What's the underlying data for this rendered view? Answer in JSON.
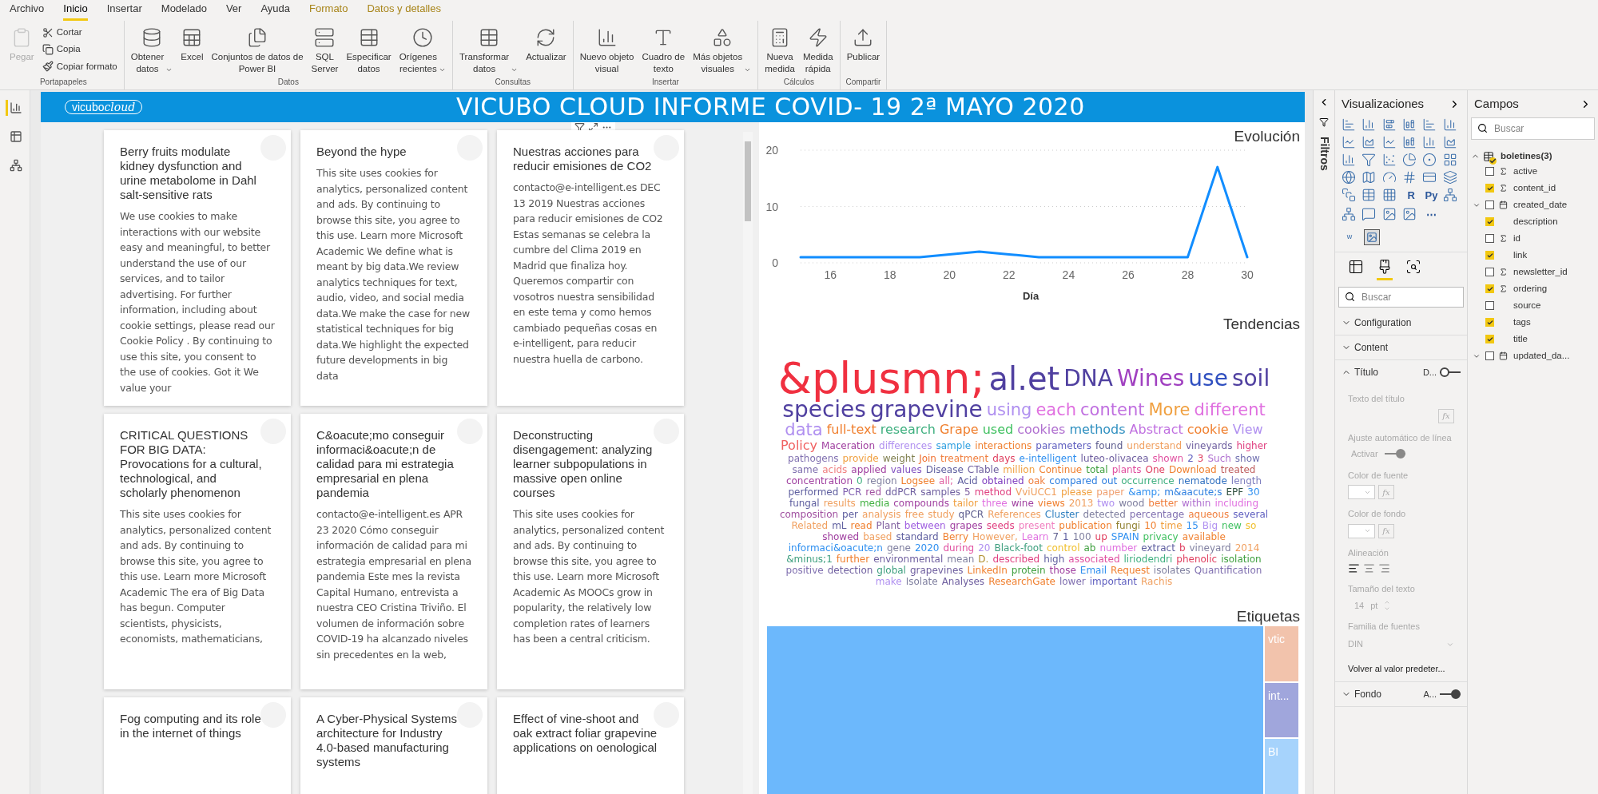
{
  "ribbon": {
    "tabs": [
      {
        "label": "Archivo",
        "selected": false,
        "kind": "normal"
      },
      {
        "label": "Inicio",
        "selected": true,
        "kind": "normal"
      },
      {
        "label": "Insertar",
        "selected": false,
        "kind": "normal"
      },
      {
        "label": "Modelado",
        "selected": false,
        "kind": "normal"
      },
      {
        "label": "Ver",
        "selected": false,
        "kind": "normal"
      },
      {
        "label": "Ayuda",
        "selected": false,
        "kind": "normal"
      },
      {
        "label": "Formato",
        "selected": false,
        "kind": "contextual"
      },
      {
        "label": "Datos y detalles",
        "selected": false,
        "kind": "contextual"
      }
    ],
    "groups": [
      {
        "label": "Portapapeles",
        "buttons": [
          {
            "label": "Pegar",
            "kind": "large",
            "disabled": true
          },
          {
            "label": "Cortar",
            "kind": "small",
            "disabled": false
          },
          {
            "label": "Copia",
            "kind": "small",
            "disabled": false
          },
          {
            "label": "Copiar formato",
            "kind": "small",
            "disabled": false
          }
        ]
      },
      {
        "label": "Datos",
        "buttons": [
          {
            "label": "Obtener\ndatos",
            "kind": "large",
            "disabled": false,
            "dropdown": true
          },
          {
            "label": "Excel",
            "kind": "large",
            "disabled": false
          },
          {
            "label": "Conjuntos de datos de\nPower BI",
            "kind": "large",
            "disabled": false
          },
          {
            "label": "SQL\nServer",
            "kind": "large",
            "disabled": false
          },
          {
            "label": "Especificar\ndatos",
            "kind": "large",
            "disabled": false
          },
          {
            "label": "Orígenes\nrecientes",
            "kind": "large",
            "disabled": false,
            "dropdown": true
          }
        ]
      },
      {
        "label": "Consultas",
        "buttons": [
          {
            "label": "Transformar\ndatos",
            "kind": "large",
            "disabled": false,
            "dropdown": true
          },
          {
            "label": "Actualizar",
            "kind": "large",
            "disabled": false
          }
        ]
      },
      {
        "label": "Insertar",
        "buttons": [
          {
            "label": "Nuevo objeto\nvisual",
            "kind": "large",
            "disabled": false
          },
          {
            "label": "Cuadro de\ntexto",
            "kind": "large",
            "disabled": false
          },
          {
            "label": "Más objetos\nvisuales",
            "kind": "large",
            "disabled": false,
            "dropdown": true
          }
        ]
      },
      {
        "label": "Cálculos",
        "buttons": [
          {
            "label": "Nueva\nmedida",
            "kind": "large",
            "disabled": false
          },
          {
            "label": "Medida\nrápida",
            "kind": "large",
            "disabled": false
          }
        ]
      },
      {
        "label": "Compartir",
        "buttons": [
          {
            "label": "Publicar",
            "kind": "large",
            "disabled": false
          }
        ]
      }
    ]
  },
  "view_rail": [
    {
      "selected": true
    },
    {
      "selected": false
    },
    {
      "selected": false
    }
  ],
  "report": {
    "header": {
      "logo_text": "vicubo",
      "logo_script": "cloud",
      "title": "VICUBO CLOUD INFORME COVID- 19 2ª MAYO 2020"
    },
    "cards": [
      {
        "title": "Berry fruits modulate kidney dysfunction and urine metabolome in Dahl salt-sensitive rats",
        "body": "We use cookies to make interactions with our website easy and meaningful, to better understand the use of our services, and to tailor advertising. For further information, including about cookie settings, please read our Cookie Policy . By continuing to use this site, you consent to the use of cookies. Got it We value your"
      },
      {
        "title": "Beyond the hype",
        "body": "This site uses cookies for analytics, personalized content and ads. By continuing to browse this site, you agree to this use. Learn more Microsoft Academic We define what is meant by big data.We review analytics techniques for text, audio, video, and social media data.We make the case for new statistical techniques for big data.We highlight the expected future developments in big data"
      },
      {
        "title": "Nuestras acciones para reducir emisiones de CO2",
        "body": "contacto@e-intelligent.es DEC 13 2019 Nuestras acciones para reducir emisiones de CO2 Estas semanas se celebra la cumbre del Clima 2019 en Madrid que finaliza hoy.  Queremos compartir con vosotros nuestra sensibilidad en este tema y como hemos cambiado pequeñas cosas en e-intelligent, para reducir nuestra huella de carbono."
      },
      {
        "title": "CRITICAL QUESTIONS FOR BIG DATA: Provocations for a cultural, technological, and scholarly phenomenon",
        "body": "This site uses cookies for analytics, personalized content and ads. By continuing to browse this site, you agree to this use. Learn more Microsoft Academic The era of Big Data has begun. Computer scientists, physicists, economists, mathematicians,"
      },
      {
        "title": "C&oacute;mo conseguir informaci&oacute;n de calidad para mi estrategia empresarial en plena pandemia",
        "body": "contacto@e-intelligent.es APR 23 2020 Cómo conseguir información de calidad para mi estrategia empresarial en plena pandemia Este mes la revista Capital Humano, entrevista a nuestra CEO Cristina Triviño. El volumen de información sobre COVID-19 ha alcanzado niveles sin precedentes en la web,"
      },
      {
        "title": "Deconstructing disengagement: analyzing learner subpopulations in massive open online courses",
        "body": "This site uses cookies for analytics, personalized content and ads. By continuing to browse this site, you agree to this use. Learn more Microsoft Academic As MOOCs grow in popularity, the relatively low completion rates of learners has been a central criticism."
      },
      {
        "title": "Fog computing and its role in the internet of things"
      },
      {
        "title": "A Cyber-Physical Systems architecture for Industry 4.0-based manufacturing systems"
      },
      {
        "title": "Effect of vine-shoot and oak extract foliar grapevine applications on oenological"
      }
    ],
    "evolution": {
      "chart_data": {
        "type": "line",
        "title": "Evolución",
        "xlabel": "Día",
        "x": [
          15,
          16,
          17,
          18,
          19,
          20,
          21,
          22,
          23,
          24,
          25,
          26,
          27,
          28,
          29,
          30
        ],
        "series": [
          {
            "color": "#118dff",
            "values": [
              1,
              1,
              1,
              1,
              1,
              1.5,
              2,
              1.5,
              1,
              1,
              1,
              1,
              1,
              1,
              17,
              1
            ]
          }
        ],
        "xlim": [
          15,
          30
        ],
        "ylim": [
          0,
          20
        ],
        "xticks": [
          16,
          18,
          20,
          22,
          24,
          26,
          28,
          30
        ],
        "yticks": [
          0,
          10,
          20
        ]
      }
    },
    "trends": {
      "title": "Tendencias",
      "words": [
        {
          "text": "&plusmn;",
          "color": "#f03040"
        },
        {
          "text": "al.et",
          "color": "#5040a0"
        },
        {
          "text": "DNA",
          "color": "#5040a0"
        },
        {
          "text": "Wines",
          "color": "#a040c0"
        },
        {
          "text": "use",
          "color": "#3050c0"
        },
        {
          "text": "soil",
          "color": "#5040a0"
        },
        {
          "text": "species",
          "color": "#5040a0"
        },
        {
          "text": "grapevine",
          "color": "#5040a0"
        },
        {
          "text": "using",
          "color": "#b090f0"
        },
        {
          "text": "each",
          "color": "#e070e0"
        },
        {
          "text": "content",
          "color": "#c070e0"
        },
        {
          "text": "More",
          "color": "#f0a040"
        },
        {
          "text": "different",
          "color": "#e070e0"
        },
        {
          "text": "data",
          "color": "#b090f0"
        },
        {
          "text": "full-text",
          "color": "#f08030"
        },
        {
          "text": "research",
          "color": "#40b080"
        },
        {
          "text": "Grape",
          "color": "#f08030"
        },
        {
          "text": "used",
          "color": "#40c060"
        },
        {
          "text": "cookies",
          "color": "#b070d0"
        },
        {
          "text": "methods",
          "color": "#3090c0"
        },
        {
          "text": "Abstract",
          "color": "#c070e0"
        },
        {
          "text": "cookie",
          "color": "#f08030"
        },
        {
          "text": "View",
          "color": "#b090f0"
        },
        {
          "text": "Policy",
          "color": "#f06060"
        },
        {
          "text": "Maceration",
          "color": "#a040a0"
        },
        {
          "text": "differences",
          "color": "#b090f0"
        },
        {
          "text": "sample",
          "color": "#30a0e0"
        },
        {
          "text": "interactions",
          "color": "#f08030"
        },
        {
          "text": "parameters",
          "color": "#6060c0"
        },
        {
          "text": "found",
          "color": "#606090"
        },
        {
          "text": "understand",
          "color": "#f0a060"
        },
        {
          "text": "vineyards",
          "color": "#7060a0"
        },
        {
          "text": "higher",
          "color": "#e04080"
        },
        {
          "text": "pathogens",
          "color": "#8070b0"
        },
        {
          "text": "provide",
          "color": "#f0a040"
        },
        {
          "text": "weight",
          "color": "#808050"
        },
        {
          "text": "Join",
          "color": "#f07030"
        },
        {
          "text": "treatment",
          "color": "#f08040"
        },
        {
          "text": "days",
          "color": "#e04060"
        },
        {
          "text": "e-intelligent",
          "color": "#3090f0"
        },
        {
          "text": "luteo-olivacea",
          "color": "#7060a0"
        },
        {
          "text": "shown",
          "color": "#e050a0"
        },
        {
          "text": "2",
          "color": "#6060c0"
        },
        {
          "text": "3",
          "color": "#e04060"
        },
        {
          "text": "Such",
          "color": "#b070d0"
        },
        {
          "text": "show",
          "color": "#7070b0"
        },
        {
          "text": "same",
          "color": "#8070b0"
        },
        {
          "text": "acids",
          "color": "#f08080"
        },
        {
          "text": "applied",
          "color": "#a040a0"
        },
        {
          "text": "values",
          "color": "#8050c0"
        },
        {
          "text": "Disease",
          "color": "#6060a0"
        },
        {
          "text": "CTable",
          "color": "#7060a0"
        },
        {
          "text": "million",
          "color": "#f0a040"
        },
        {
          "text": "Continue",
          "color": "#f08030"
        },
        {
          "text": "total",
          "color": "#40a040"
        },
        {
          "text": "plants",
          "color": "#e050a0"
        },
        {
          "text": "One",
          "color": "#e04060"
        },
        {
          "text": "Download",
          "color": "#f08030"
        },
        {
          "text": "treated",
          "color": "#c06060"
        },
        {
          "text": "concentration",
          "color": "#a040a0"
        },
        {
          "text": "0",
          "color": "#40b080"
        },
        {
          "text": "region",
          "color": "#8080a0"
        },
        {
          "text": "Logsee",
          "color": "#f08030"
        },
        {
          "text": "all;",
          "color": "#e060a0"
        },
        {
          "text": "Acid",
          "color": "#6060a0"
        },
        {
          "text": "obtained",
          "color": "#8040c0"
        },
        {
          "text": "oak",
          "color": "#f08040"
        },
        {
          "text": "compared",
          "color": "#3080e0"
        },
        {
          "text": "out",
          "color": "#3080e0"
        },
        {
          "text": "occurrence",
          "color": "#40b080"
        },
        {
          "text": "nematode",
          "color": "#3070c0"
        },
        {
          "text": "length",
          "color": "#8080c0"
        },
        {
          "text": "performed",
          "color": "#6060a0"
        },
        {
          "text": "PCR",
          "color": "#8060b0"
        },
        {
          "text": "red",
          "color": "#a050a0"
        },
        {
          "text": "ddPCR",
          "color": "#7060a0"
        },
        {
          "text": "samples",
          "color": "#7060a0"
        },
        {
          "text": "5",
          "color": "#8060a0"
        },
        {
          "text": "method",
          "color": "#e04080"
        },
        {
          "text": "VviUCC1",
          "color": "#f0a060"
        },
        {
          "text": "please",
          "color": "#f0a040"
        },
        {
          "text": "paper",
          "color": "#f0a070"
        },
        {
          "text": "&amp;",
          "color": "#3090f0"
        },
        {
          "text": "m&aacute;s",
          "color": "#3080e0"
        },
        {
          "text": "EPF",
          "color": "#305040"
        },
        {
          "text": "30",
          "color": "#3090f0"
        },
        {
          "text": "fungal",
          "color": "#6060a0"
        },
        {
          "text": "results",
          "color": "#f0a060"
        },
        {
          "text": "media",
          "color": "#40b040"
        },
        {
          "text": "compounds",
          "color": "#a040a0"
        },
        {
          "text": "tailor",
          "color": "#f0a040"
        },
        {
          "text": "three",
          "color": "#e070e0"
        },
        {
          "text": "wine",
          "color": "#a040a0"
        },
        {
          "text": "views",
          "color": "#f08030"
        },
        {
          "text": "2013",
          "color": "#f0a060"
        },
        {
          "text": "two",
          "color": "#b090f0"
        },
        {
          "text": "wood",
          "color": "#8080a0"
        },
        {
          "text": "better",
          "color": "#f08040"
        },
        {
          "text": "within",
          "color": "#b070d0"
        },
        {
          "text": "including",
          "color": "#e070e0"
        },
        {
          "text": "composition",
          "color": "#a050a0"
        },
        {
          "text": "per",
          "color": "#6060a0"
        },
        {
          "text": "analysis",
          "color": "#f0a060"
        },
        {
          "text": "free",
          "color": "#f0a060"
        },
        {
          "text": "study",
          "color": "#f0a060"
        },
        {
          "text": "qPCR",
          "color": "#606090"
        },
        {
          "text": "References",
          "color": "#f0a060"
        },
        {
          "text": "Cluster",
          "color": "#3080c0"
        },
        {
          "text": "detected",
          "color": "#8080a0"
        },
        {
          "text": "percentage",
          "color": "#8070b0"
        },
        {
          "text": "aqueous",
          "color": "#f08040"
        },
        {
          "text": "several",
          "color": "#6060c0"
        },
        {
          "text": "Related",
          "color": "#f0a060"
        },
        {
          "text": "mL",
          "color": "#6060a0"
        },
        {
          "text": "read",
          "color": "#f08030"
        },
        {
          "text": "Plant",
          "color": "#8060a0"
        },
        {
          "text": "between",
          "color": "#a060e0"
        },
        {
          "text": "grapes",
          "color": "#a040a0"
        },
        {
          "text": "seeds",
          "color": "#e04080"
        },
        {
          "text": "present",
          "color": "#f080c0"
        },
        {
          "text": "publication",
          "color": "#f08030"
        },
        {
          "text": "fungi",
          "color": "#908030"
        },
        {
          "text": "10",
          "color": "#f08030"
        },
        {
          "text": "time",
          "color": "#f0a040"
        },
        {
          "text": "15",
          "color": "#3090f0"
        },
        {
          "text": "Big",
          "color": "#b090f0"
        },
        {
          "text": "new",
          "color": "#40c060"
        },
        {
          "text": "so",
          "color": "#f0c030"
        },
        {
          "text": "showed",
          "color": "#a040a0"
        },
        {
          "text": "based",
          "color": "#f0a060"
        },
        {
          "text": "standard",
          "color": "#6060a0"
        },
        {
          "text": "Berry",
          "color": "#f08030"
        },
        {
          "text": "However,",
          "color": "#f0a060"
        },
        {
          "text": "Learn",
          "color": "#e070e0"
        },
        {
          "text": "7",
          "color": "#606090"
        },
        {
          "text": "1",
          "color": "#6060a0"
        },
        {
          "text": "100",
          "color": "#8080a0"
        },
        {
          "text": "up",
          "color": "#e04060"
        },
        {
          "text": "SPAIN",
          "color": "#3090f0"
        },
        {
          "text": "privacy",
          "color": "#40c060"
        },
        {
          "text": "available",
          "color": "#f08030"
        },
        {
          "text": "informaci&oacute;n",
          "color": "#3090f0"
        },
        {
          "text": "gene",
          "color": "#8080a0"
        },
        {
          "text": "2020",
          "color": "#3090f0"
        },
        {
          "text": "during",
          "color": "#e050a0"
        },
        {
          "text": "20",
          "color": "#b090f0"
        },
        {
          "text": "Black-foot",
          "color": "#40a080"
        },
        {
          "text": "control",
          "color": "#f0c030"
        },
        {
          "text": "ab",
          "color": "#40a040"
        },
        {
          "text": "number",
          "color": "#e070e0"
        },
        {
          "text": "extract",
          "color": "#6060a0"
        },
        {
          "text": "b",
          "color": "#e04060"
        },
        {
          "text": "vineyard",
          "color": "#8080a0"
        },
        {
          "text": "2014",
          "color": "#f0a060"
        },
        {
          "text": "&minus;1",
          "color": "#40a080"
        },
        {
          "text": "further",
          "color": "#f08030"
        },
        {
          "text": "environmental",
          "color": "#7060a0"
        },
        {
          "text": "mean",
          "color": "#8080a0"
        },
        {
          "text": "D.",
          "color": "#b09030"
        },
        {
          "text": "described",
          "color": "#e04080"
        },
        {
          "text": "high",
          "color": "#6060a0"
        },
        {
          "text": "associated",
          "color": "#e050a0"
        },
        {
          "text": "liriodendri",
          "color": "#40b080"
        },
        {
          "text": "phenolic",
          "color": "#e04060"
        },
        {
          "text": "isolation",
          "color": "#40a040"
        },
        {
          "text": "positive",
          "color": "#8070b0"
        },
        {
          "text": "detection",
          "color": "#7060a0"
        },
        {
          "text": "global",
          "color": "#40a080"
        },
        {
          "text": "grapevines",
          "color": "#7060a0"
        },
        {
          "text": "LinkedIn",
          "color": "#f08030"
        },
        {
          "text": "protein",
          "color": "#40a040"
        },
        {
          "text": "those",
          "color": "#a040a0"
        },
        {
          "text": "Email",
          "color": "#3090f0"
        },
        {
          "text": "Request",
          "color": "#f08030"
        },
        {
          "text": "isolates",
          "color": "#8080a0"
        },
        {
          "text": "Quantification",
          "color": "#8070b0"
        },
        {
          "text": "make",
          "color": "#b090f0"
        },
        {
          "text": "Isolate",
          "color": "#8080a0"
        },
        {
          "text": "Analyses",
          "color": "#7060a0"
        },
        {
          "text": "ResearchGate",
          "color": "#f08030"
        },
        {
          "text": "lower",
          "color": "#8070b0"
        },
        {
          "text": "important",
          "color": "#6060c0"
        },
        {
          "text": "Rachis",
          "color": "#f0a060"
        }
      ]
    },
    "tags": {
      "title": "Etiquetas",
      "tiles": [
        {
          "color": "#6cb8fc"
        },
        {
          "label": "vtic",
          "color": "#f2c3ac"
        },
        {
          "label": "int...",
          "color": "#a0a6dc"
        },
        {
          "label": "BI",
          "color": "#a6d3fc"
        }
      ]
    }
  },
  "filters": {
    "title": "Filtros"
  },
  "visualizations": {
    "title": "Visualizaciones",
    "gallery_texts": [
      "R",
      "Py",
      "⋯"
    ],
    "custom_visuals": [
      {
        "label": "w",
        "selected": false
      },
      {
        "selected": true
      }
    ],
    "pane_tabs": [
      {
        "selected": false
      },
      {
        "selected": true
      },
      {
        "selected": false
      }
    ],
    "search": {
      "placeholder": "Buscar"
    },
    "sections": [
      {
        "title": "Configuration",
        "expanded": false
      },
      {
        "title": "Content",
        "expanded": false
      },
      {
        "title": "Título",
        "expanded": true,
        "toggle_label": "D...",
        "on": false,
        "disabled": true,
        "fields": [
          {
            "kind": "fx",
            "label": "Texto del título",
            "fx": "fx"
          },
          {
            "kind": "toggle",
            "label": "Ajuste automático de línea",
            "toggle_label": "Activar",
            "on": true
          },
          {
            "kind": "color",
            "label": "Color de fuente",
            "fx": "fx"
          },
          {
            "kind": "color",
            "label": "Color de fondo",
            "fx": "fx"
          },
          {
            "kind": "align",
            "label": "Alineación",
            "options": [
              {
                "selected": true
              },
              {
                "selected": false
              },
              {
                "selected": false
              }
            ]
          },
          {
            "kind": "number",
            "label": "Tamaño del texto",
            "value": "14",
            "unit": "pt"
          },
          {
            "kind": "select",
            "label": "Familia de fuentes",
            "value": "DIN"
          },
          {
            "kind": "link",
            "label": "Volver al valor predeter..."
          }
        ]
      },
      {
        "title": "Fondo",
        "expanded": false,
        "toggle_label": "A...",
        "on": true
      }
    ]
  },
  "fields": {
    "title": "Campos",
    "search": {
      "placeholder": "Buscar"
    },
    "tables": [
      {
        "name": "boletines(3)",
        "expanded": true,
        "fields": [
          {
            "name": "active",
            "checked": false,
            "kind": "sum"
          },
          {
            "name": "content_id",
            "checked": true,
            "kind": "sum"
          },
          {
            "name": "created_date",
            "checked": false,
            "kind": "date",
            "expanded": false
          },
          {
            "name": "description",
            "checked": true,
            "kind": "text"
          },
          {
            "name": "id",
            "checked": false,
            "kind": "sum"
          },
          {
            "name": "link",
            "checked": true,
            "kind": "text"
          },
          {
            "name": "newsletter_id",
            "checked": false,
            "kind": "sum"
          },
          {
            "name": "ordering",
            "checked": true,
            "kind": "sum"
          },
          {
            "name": "source",
            "checked": false,
            "kind": "text"
          },
          {
            "name": "tags",
            "checked": true,
            "kind": "text"
          },
          {
            "name": "title",
            "checked": true,
            "kind": "text"
          },
          {
            "name": "updated_da...",
            "checked": false,
            "kind": "date",
            "expanded": false
          }
        ]
      }
    ]
  }
}
